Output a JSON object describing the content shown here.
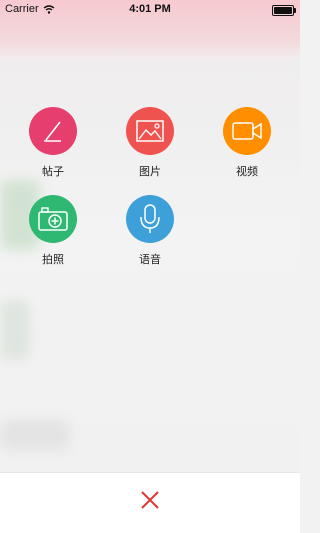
{
  "status_bar": {
    "carrier": "Carrier",
    "time": "4:01 PM",
    "battery_level": 1.0
  },
  "actions": [
    {
      "label": "帖子",
      "icon": "edit-icon",
      "color": "#e63e6d"
    },
    {
      "label": "图片",
      "icon": "image-icon",
      "color": "#ef5350"
    },
    {
      "label": "视频",
      "icon": "video-icon",
      "color": "#ff8f00"
    },
    {
      "label": "拍照",
      "icon": "camera-add-icon",
      "color": "#2eb872"
    },
    {
      "label": "语音",
      "icon": "mic-icon",
      "color": "#3ea0d8"
    }
  ],
  "close_button": {
    "icon": "close-icon",
    "color": "#e53935"
  }
}
